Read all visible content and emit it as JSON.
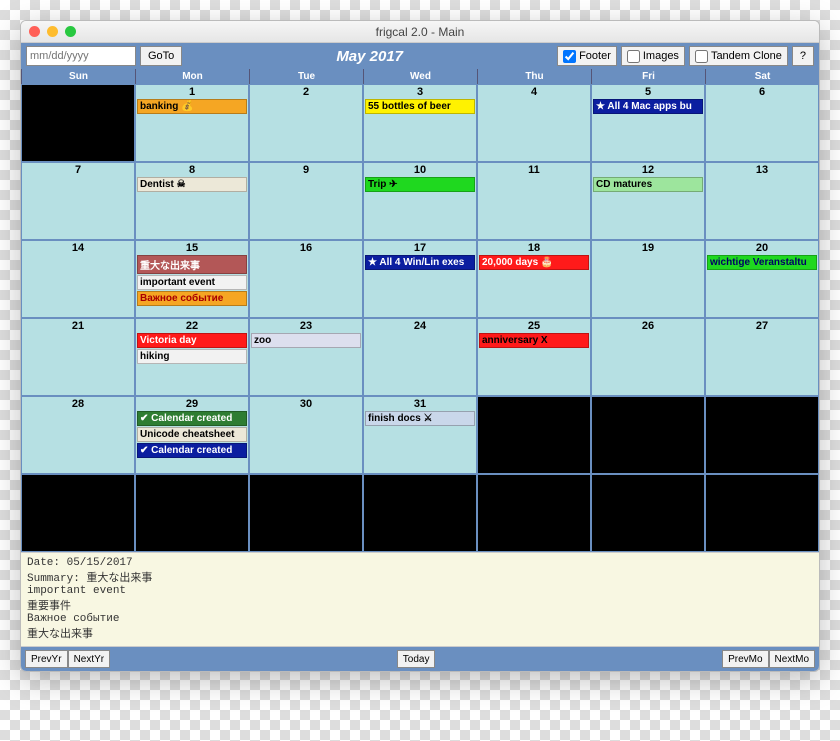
{
  "window": {
    "title": "frigcal 2.0 - Main"
  },
  "toolbar": {
    "date_placeholder": "mm/dd/yyyy",
    "date_value": "",
    "goto_label": "GoTo",
    "month_title": "May 2017",
    "footer_checked": true,
    "footer_label": "Footer",
    "images_checked": false,
    "images_label": "Images",
    "tandem_checked": false,
    "tandem_label": "Tandem Clone",
    "help_label": "?"
  },
  "dow": [
    "Sun",
    "Mon",
    "Tue",
    "Wed",
    "Thu",
    "Fri",
    "Sat"
  ],
  "weeks": [
    [
      {
        "out": true
      },
      {
        "num": "1",
        "events": [
          {
            "text": "banking 💰",
            "bg": "#f5a623",
            "fg": "#000"
          }
        ]
      },
      {
        "num": "2"
      },
      {
        "num": "3",
        "events": [
          {
            "text": "55 bottles of beer",
            "bg": "#fff200",
            "fg": "#000"
          }
        ]
      },
      {
        "num": "4"
      },
      {
        "num": "5",
        "events": [
          {
            "text": "★ All 4 Mac apps bu",
            "bg": "#0b1ea0",
            "fg": "#fff"
          }
        ]
      },
      {
        "num": "6"
      }
    ],
    [
      {
        "num": "7"
      },
      {
        "num": "8",
        "events": [
          {
            "text": "Dentist ☠",
            "bg": "#ece8d8",
            "fg": "#000"
          }
        ]
      },
      {
        "num": "9"
      },
      {
        "num": "10",
        "events": [
          {
            "text": "Trip ✈",
            "bg": "#1fd81f",
            "fg": "#000"
          }
        ]
      },
      {
        "num": "11"
      },
      {
        "num": "12",
        "events": [
          {
            "text": "CD matures",
            "bg": "#9de59d",
            "fg": "#000"
          }
        ]
      },
      {
        "num": "13"
      }
    ],
    [
      {
        "num": "14"
      },
      {
        "num": "15",
        "events": [
          {
            "text": "重大な出来事",
            "bg": "#b35757",
            "fg": "#fff"
          },
          {
            "text": "important event",
            "bg": "#f2f2f2",
            "fg": "#000"
          },
          {
            "text": "Важное событие",
            "bg": "#f5a623",
            "fg": "#a00"
          }
        ]
      },
      {
        "num": "16"
      },
      {
        "num": "17",
        "events": [
          {
            "text": "★ All 4 Win/Lin exes",
            "bg": "#0b1ea0",
            "fg": "#fff"
          }
        ]
      },
      {
        "num": "18",
        "events": [
          {
            "text": "20,000 days 🎂",
            "bg": "#ff1a1a",
            "fg": "#fff"
          }
        ]
      },
      {
        "num": "19"
      },
      {
        "num": "20",
        "events": [
          {
            "text": "wichtige Veranstaltu",
            "bg": "#1fd81f",
            "fg": "#006"
          }
        ]
      }
    ],
    [
      {
        "num": "21"
      },
      {
        "num": "22",
        "events": [
          {
            "text": "Victoria day",
            "bg": "#ff1a1a",
            "fg": "#fff"
          },
          {
            "text": "hiking",
            "bg": "#f2f2f2",
            "fg": "#000"
          }
        ]
      },
      {
        "num": "23",
        "events": [
          {
            "text": "zoo",
            "bg": "#dcdfee",
            "fg": "#000"
          }
        ]
      },
      {
        "num": "24"
      },
      {
        "num": "25",
        "events": [
          {
            "text": "anniversary X",
            "bg": "#ff1a1a",
            "fg": "#000"
          }
        ]
      },
      {
        "num": "26"
      },
      {
        "num": "27"
      }
    ],
    [
      {
        "num": "28"
      },
      {
        "num": "29",
        "events": [
          {
            "text": "✔ Calendar created",
            "bg": "#2e7d32",
            "fg": "#fff"
          },
          {
            "text": "Unicode cheatsheet",
            "bg": "#ece8d8",
            "fg": "#000"
          },
          {
            "text": "✔ Calendar created",
            "bg": "#0b1ea0",
            "fg": "#fff"
          }
        ]
      },
      {
        "num": "30"
      },
      {
        "num": "31",
        "events": [
          {
            "text": "finish docs ⚔",
            "bg": "#c9d7ea",
            "fg": "#000"
          }
        ]
      },
      {
        "out": true
      },
      {
        "out": true
      },
      {
        "out": true
      }
    ],
    [
      {
        "out": true
      },
      {
        "out": true
      },
      {
        "out": true
      },
      {
        "out": true
      },
      {
        "out": true
      },
      {
        "out": true
      },
      {
        "out": true
      }
    ]
  ],
  "footer_text": "Date: 05/15/2017\nSummary: 重大な出来事\nimportant event\n重要事件\nВажное событие\n重大な出来事",
  "bottom": {
    "prevyr": "PrevYr",
    "nextyr": "NextYr",
    "today": "Today",
    "prevmo": "PrevMo",
    "nextmo": "NextMo"
  }
}
